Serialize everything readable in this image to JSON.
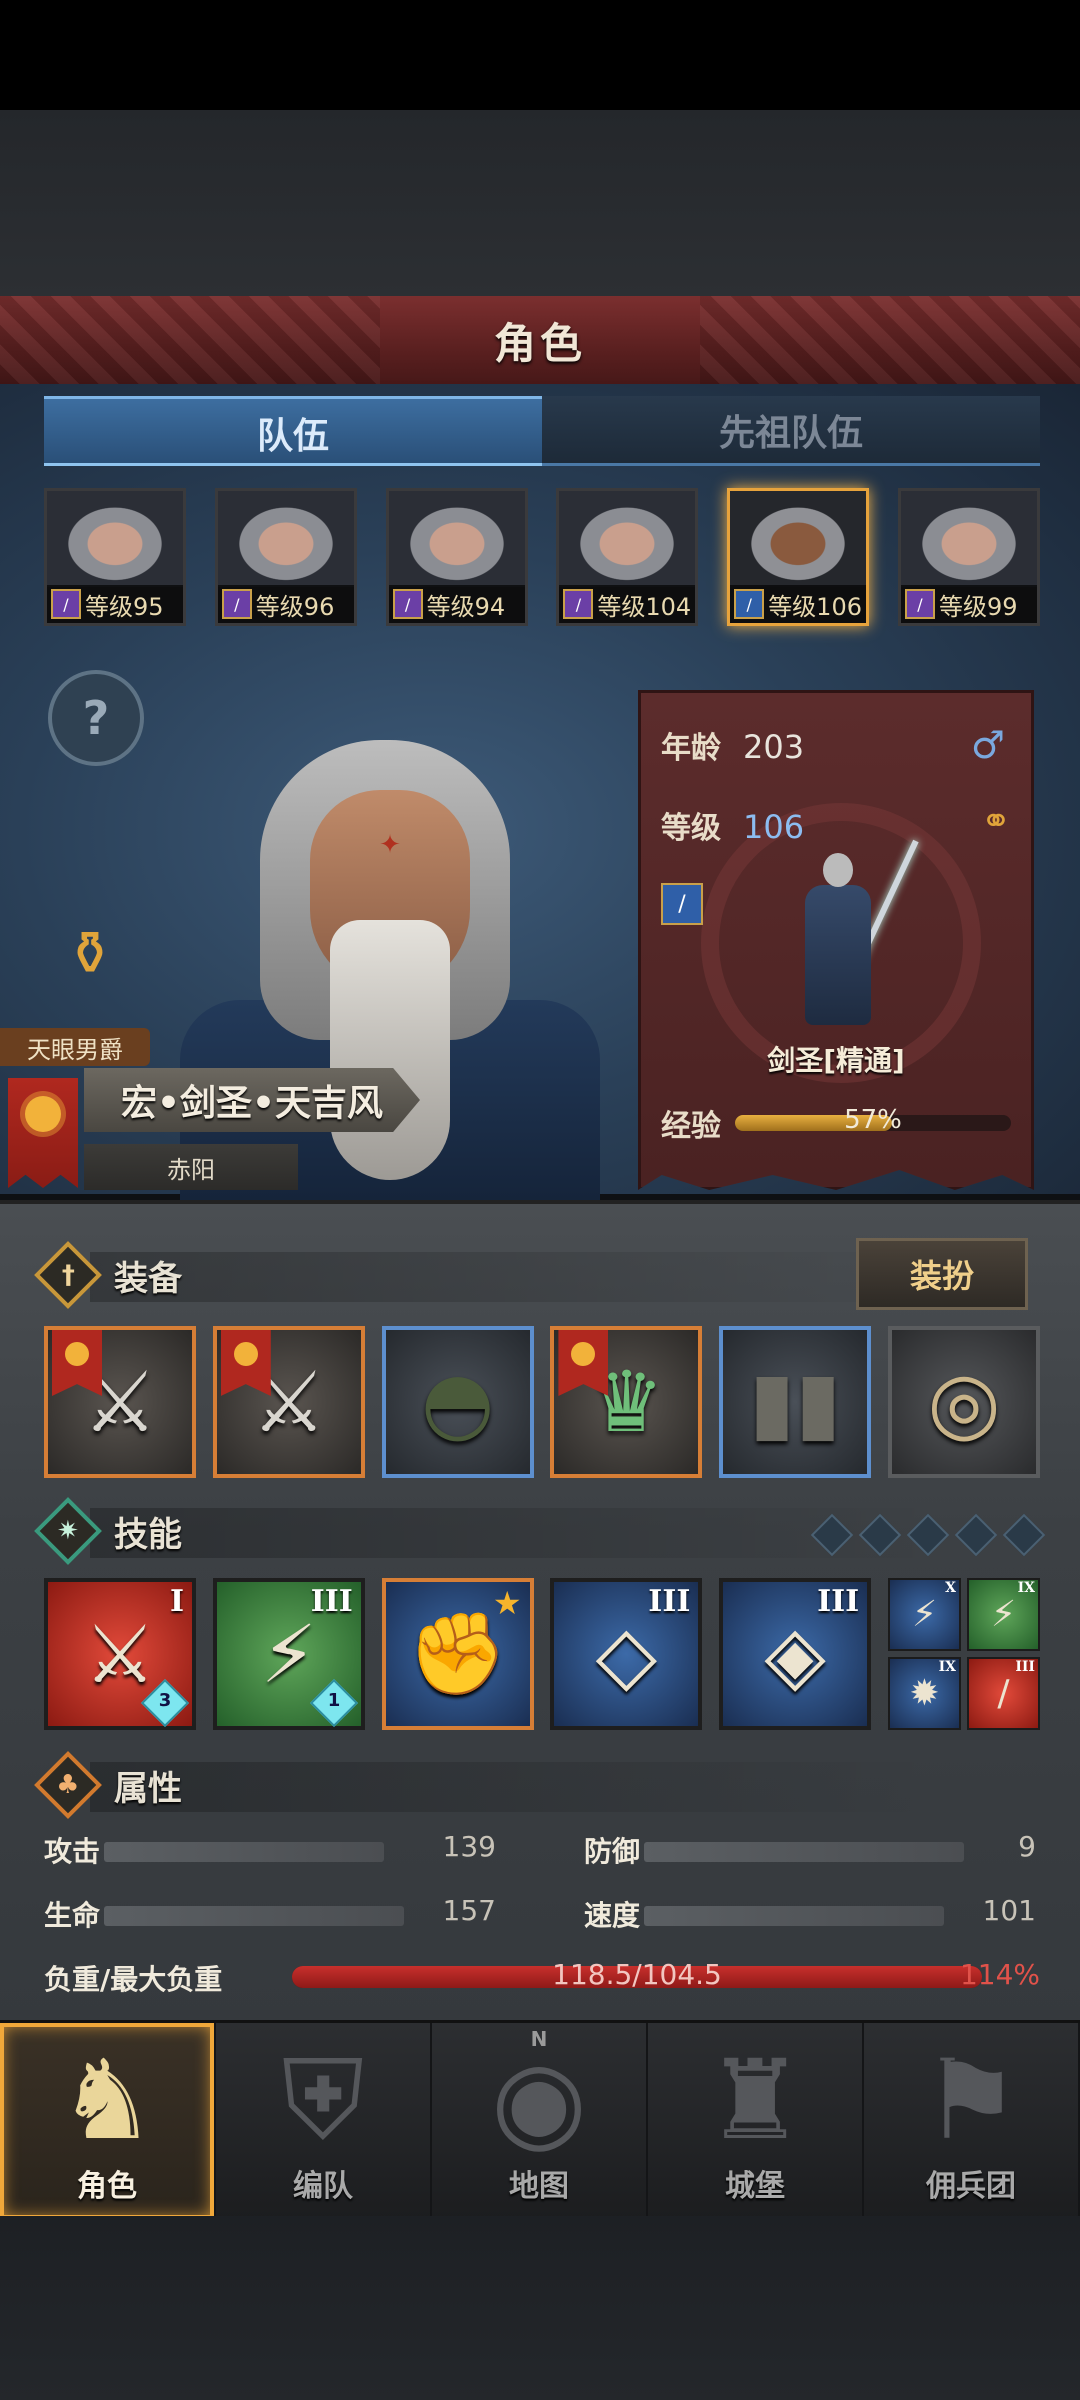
{
  "header": {
    "title": "角色"
  },
  "tabs": [
    {
      "label": "队伍",
      "active": true
    },
    {
      "label": "先祖队伍",
      "active": false
    }
  ],
  "party": [
    {
      "level_label": "等级95",
      "class_icon": "staff-icon",
      "selected": false
    },
    {
      "level_label": "等级96",
      "class_icon": "staff-icon",
      "selected": false
    },
    {
      "level_label": "等级94",
      "class_icon": "staff-icon",
      "selected": false
    },
    {
      "level_label": "等级104",
      "class_icon": "staff-icon",
      "selected": false
    },
    {
      "level_label": "等级106",
      "class_icon": "sword-icon",
      "selected": true
    },
    {
      "level_label": "等级99",
      "class_icon": "staff-icon",
      "selected": false
    }
  ],
  "help_button": {
    "label": "?"
  },
  "character": {
    "title": "天眼男爵",
    "name": "宏•剑圣•天吉风",
    "faction": "赤阳",
    "age_label": "年龄",
    "age": "203",
    "level_label": "等级",
    "level": "106",
    "class_name": "剑圣[精通]",
    "exp_label": "经验",
    "exp_percent_text": "57%",
    "exp_fraction": 0.57
  },
  "equipment": {
    "label": "装备",
    "dress_button": "装扮",
    "slots": [
      {
        "name": "axe-1",
        "rarity": "orange",
        "icon": "axe-icon"
      },
      {
        "name": "axe-2",
        "rarity": "orange",
        "icon": "axe-icon"
      },
      {
        "name": "hood",
        "rarity": "blue",
        "icon": "hood-icon"
      },
      {
        "name": "armor",
        "rarity": "orange",
        "icon": "armor-icon"
      },
      {
        "name": "boots",
        "rarity": "blue",
        "icon": "boots-icon"
      },
      {
        "name": "ring",
        "rarity": "gray",
        "icon": "ring-icon"
      }
    ]
  },
  "skills": {
    "label": "技能",
    "main": [
      {
        "color": "red",
        "rank": "I",
        "level": "3"
      },
      {
        "color": "green",
        "rank": "III",
        "level": "1"
      },
      {
        "color": "blue",
        "rank": "",
        "starred": true
      },
      {
        "color": "blue",
        "rank": "III"
      },
      {
        "color": "blue",
        "rank": "III"
      }
    ],
    "mini": [
      {
        "color": "blue",
        "rank": "X"
      },
      {
        "color": "green",
        "rank": "IX"
      },
      {
        "color": "blue",
        "rank": "IX"
      },
      {
        "color": "red",
        "rank": "III"
      }
    ]
  },
  "attributes": {
    "label": "属性",
    "attack_label": "攻击",
    "attack": "139",
    "defense_label": "防御",
    "defense": "9",
    "hp_label": "生命",
    "hp": "157",
    "speed_label": "速度",
    "speed": "101",
    "load_label": "负重/最大负重",
    "load_text": "118.5/104.5",
    "load_percent": "114%"
  },
  "nav": [
    {
      "label": "角色",
      "active": true
    },
    {
      "label": "编队",
      "active": false
    },
    {
      "label": "地图",
      "active": false,
      "compass_mark": "N"
    },
    {
      "label": "城堡",
      "active": false
    },
    {
      "label": "佣兵团",
      "active": false
    }
  ]
}
